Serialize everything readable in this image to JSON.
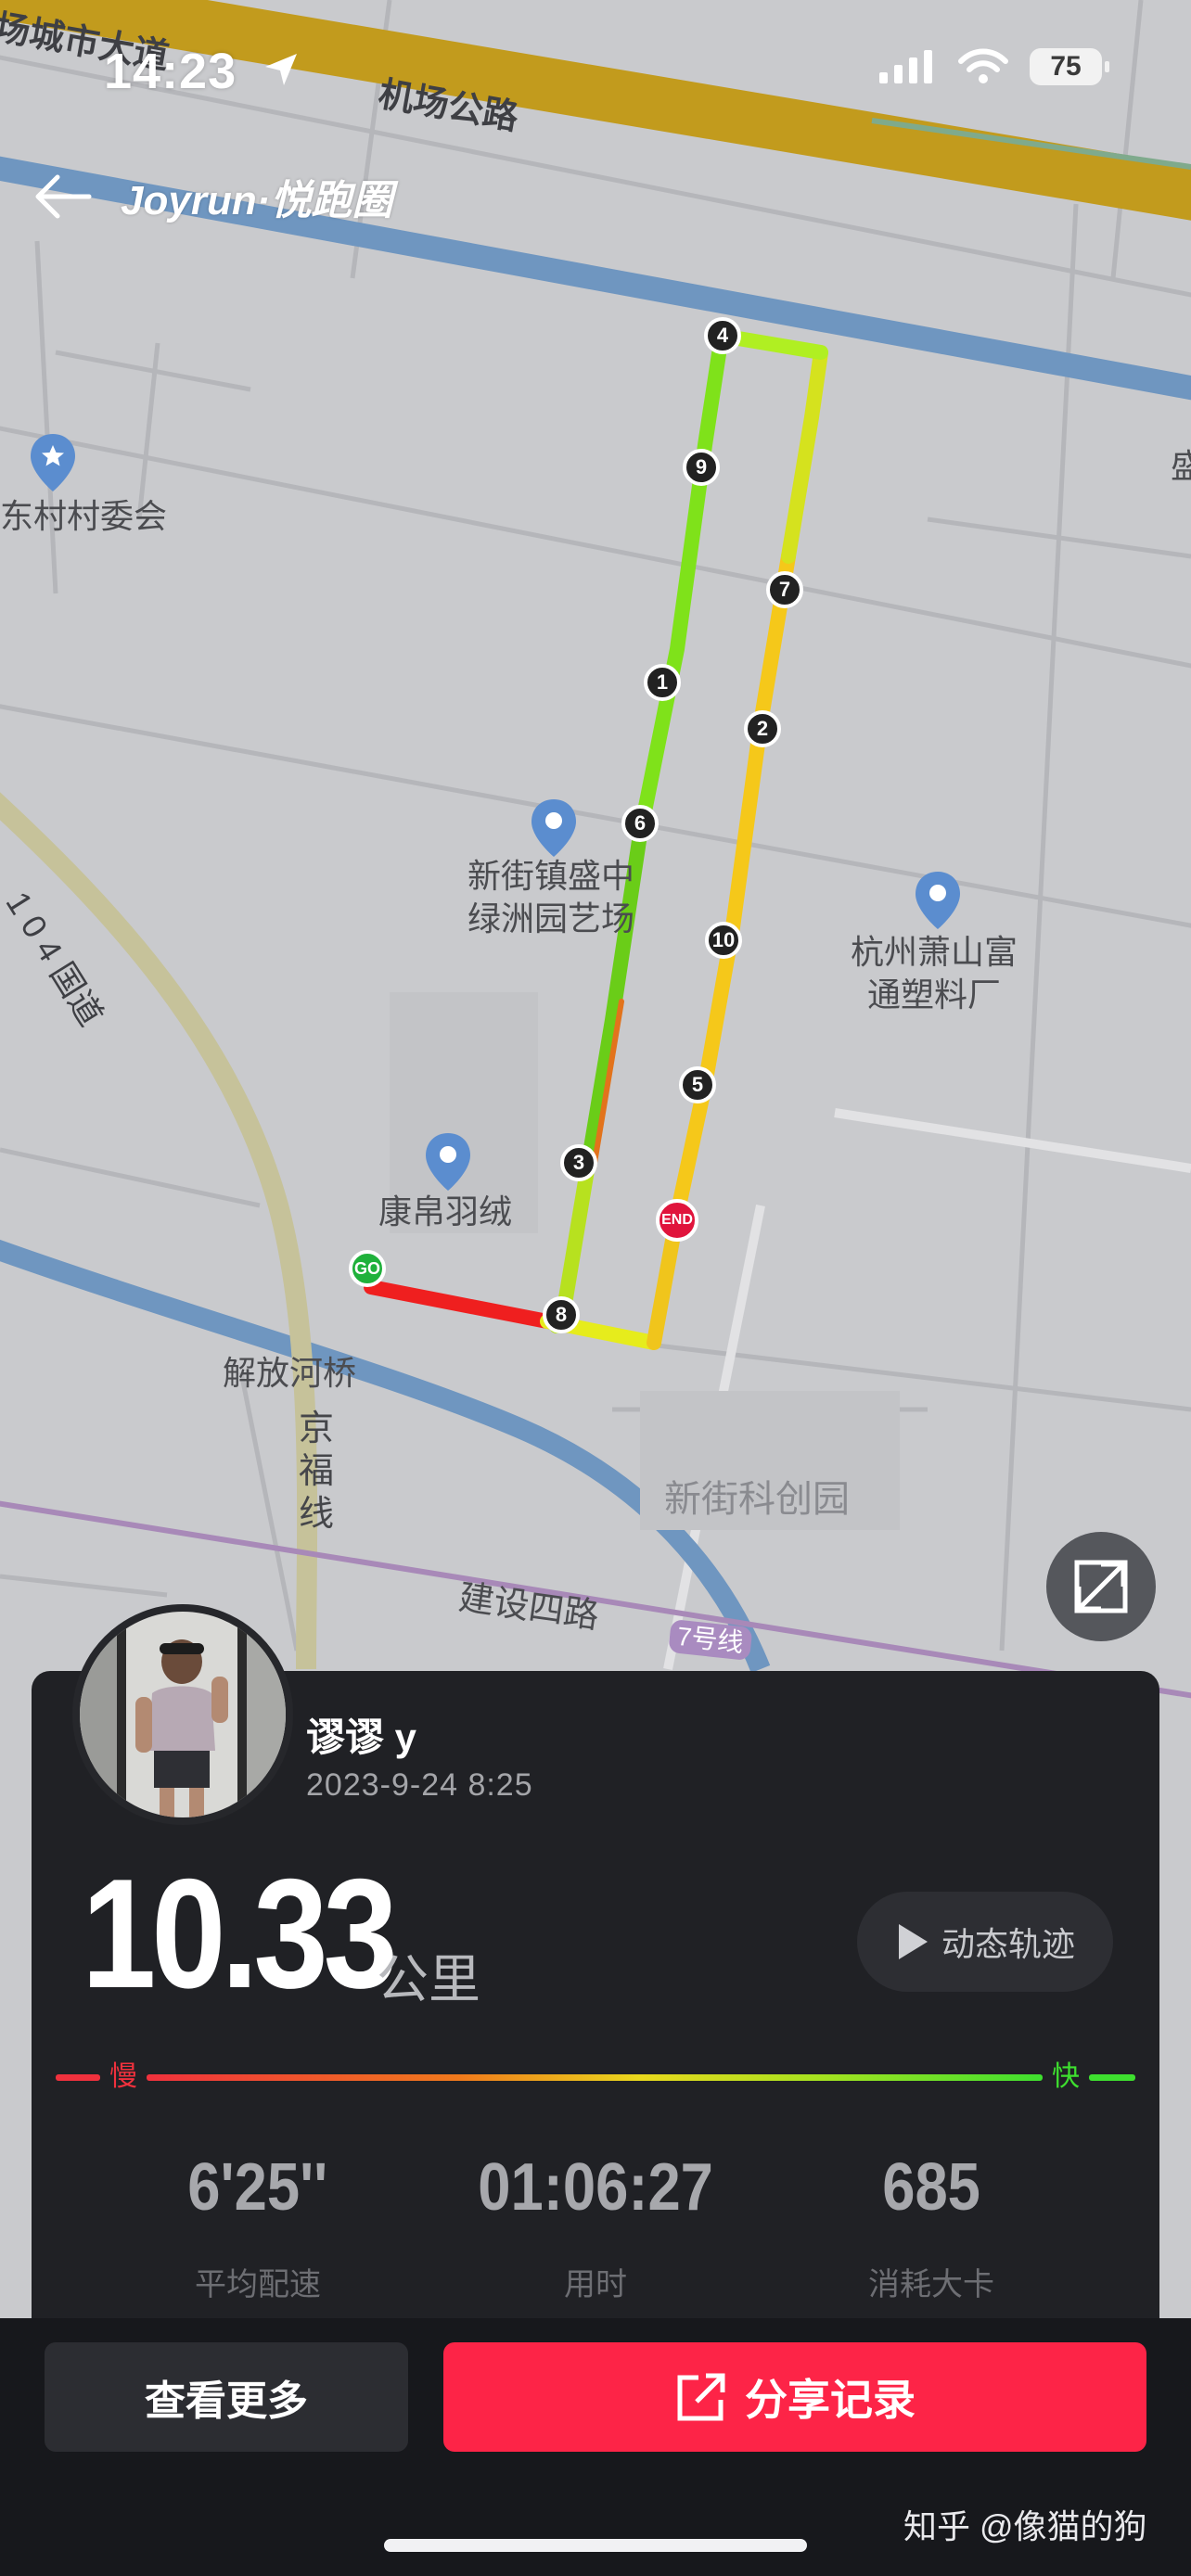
{
  "status_bar": {
    "time": "14:23",
    "battery": "75"
  },
  "nav": {
    "title": "Joyrun·悦跑圈"
  },
  "map": {
    "road_labels": [
      "场城市大道",
      "机场公路",
      "1 0 4 国道",
      "京福线",
      "建设四路",
      "7号线"
    ],
    "labels": {
      "village_committee": "东村村委会",
      "park": "新街镇盛中绿洲园艺场",
      "factory": "杭州萧山富通塑料厂",
      "kangbo": "康帛羽绒",
      "bridge": "解放河桥",
      "tech_park": "新街科创园",
      "edge_label": "盛"
    },
    "markers": [
      "4",
      "9",
      "7",
      "1",
      "2",
      "6",
      "10",
      "5",
      "3",
      "8"
    ],
    "go_label": "GO",
    "end_label": "END"
  },
  "run": {
    "username": "谬谬 y",
    "datetime": "2023-9-24 8:25",
    "distance": "10.33",
    "distance_unit": "公里",
    "replay_label": "动态轨迹",
    "pace_slow": "慢",
    "pace_fast": "快",
    "stats": [
      {
        "value": "6'25''",
        "label": "平均配速"
      },
      {
        "value": "01:06:27",
        "label": "用时"
      },
      {
        "value": "685",
        "label": "消耗大卡"
      }
    ]
  },
  "actions": {
    "more": "查看更多",
    "share": "分享记录"
  },
  "watermark": "知乎 @像猫的狗",
  "colors": {
    "share": "#fd2447",
    "slow": "#f0313d",
    "fast": "#3ee02f"
  }
}
